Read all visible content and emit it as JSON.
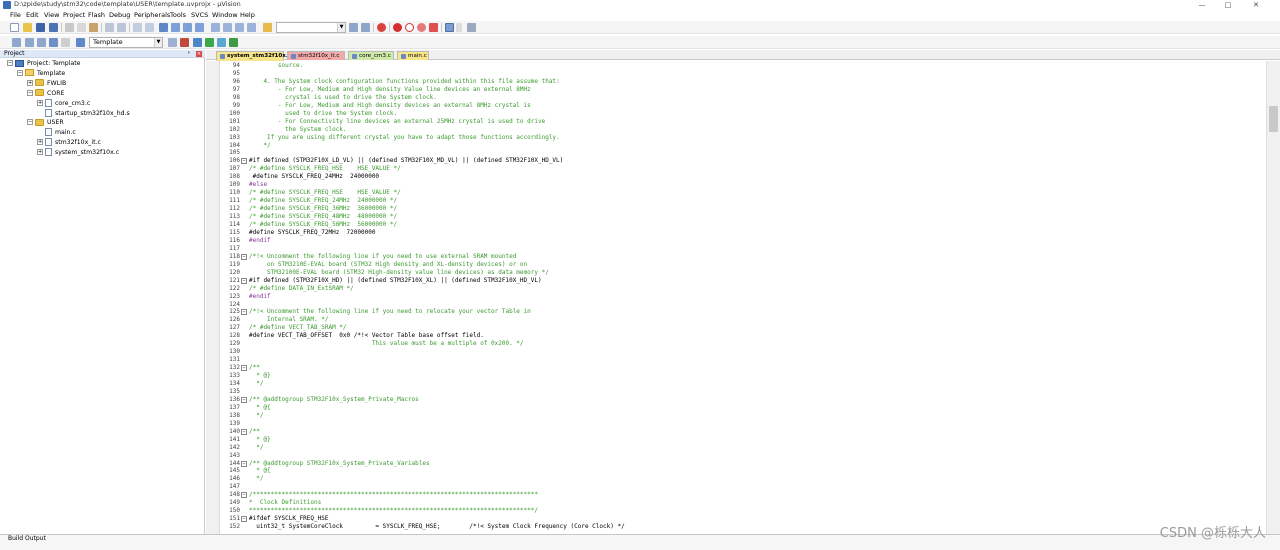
{
  "window": {
    "title": "D:\\zpide\\study\\stm32\\code\\template\\USER\\template.uvprojx - µVision",
    "controls": [
      "—",
      "□",
      "✕"
    ]
  },
  "menu": [
    "File",
    "Edit",
    "View",
    "Project",
    "Flash",
    "Debug",
    "Peripherals",
    "Tools",
    "SVCS",
    "Window",
    "Help"
  ],
  "toolbar": {
    "target_select": "Template"
  },
  "project_panel": {
    "header": "Project",
    "tree": [
      {
        "label": "Project: Template",
        "icon": "project-icon",
        "level": 0,
        "expander": "−"
      },
      {
        "label": "Template",
        "icon": "target-icon",
        "level": 1,
        "expander": "−"
      },
      {
        "label": "FWLIB",
        "icon": "folder-icon",
        "level": 2,
        "expander": "+"
      },
      {
        "label": "CORE",
        "icon": "folder-icon",
        "level": 2,
        "expander": "−"
      },
      {
        "label": "core_cm3.c",
        "icon": "file-icon",
        "level": 3,
        "expander": "+"
      },
      {
        "label": "startup_stm32f10x_hd.s",
        "icon": "file-icon",
        "level": 3,
        "expander": ""
      },
      {
        "label": "USER",
        "icon": "folder-icon",
        "level": 2,
        "expander": "−"
      },
      {
        "label": "main.c",
        "icon": "file-icon",
        "level": 3,
        "expander": ""
      },
      {
        "label": "stm32f10x_it.c",
        "icon": "file-icon",
        "level": 3,
        "expander": "+"
      },
      {
        "label": "system_stm32f10x.c",
        "icon": "file-icon",
        "level": 3,
        "expander": "+"
      }
    ]
  },
  "editor": {
    "tabs": [
      {
        "label": "system_stm32f10x.c",
        "active": true,
        "color": "#f7e58a"
      },
      {
        "label": "stm32f10x_it.c",
        "active": false,
        "color": "#f2a9a9"
      },
      {
        "label": "core_cm3.c",
        "active": false,
        "color": "#cfe9a9"
      },
      {
        "label": "main.c",
        "active": false,
        "color": "#f7e58a"
      }
    ],
    "lines": [
      {
        "n": "94",
        "t": "        source.",
        "c": "comment"
      },
      {
        "n": "95",
        "t": "",
        "c": "comment"
      },
      {
        "n": "96",
        "t": "    4. The System clock configuration functions provided within this file assume that:",
        "c": "comment"
      },
      {
        "n": "97",
        "t": "        - For Low, Medium and High density Value line devices an external 8MHz",
        "c": "comment"
      },
      {
        "n": "98",
        "t": "          crystal is used to drive the System clock.",
        "c": "comment"
      },
      {
        "n": "99",
        "t": "        - For Low, Medium and High density devices an external 8MHz crystal is",
        "c": "comment"
      },
      {
        "n": "100",
        "t": "          used to drive the System clock.",
        "c": "comment"
      },
      {
        "n": "101",
        "t": "        - For Connectivity line devices an external 25MHz crystal is used to drive",
        "c": "comment"
      },
      {
        "n": "102",
        "t": "          the System clock.",
        "c": "comment"
      },
      {
        "n": "103",
        "t": "     If you are using different crystal you have to adapt those functions accordingly.",
        "c": "comment"
      },
      {
        "n": "104",
        "t": "    */",
        "c": "comment"
      },
      {
        "n": "105",
        "t": "",
        "c": "def"
      },
      {
        "n": "106",
        "t": "#if defined (STM32F10X_LD_VL) || (defined STM32F10X_MD_VL) || (defined STM32F10X_HD_VL)",
        "c": "def",
        "fold": "−"
      },
      {
        "n": "107",
        "t": "/* #define SYSCLK_FREQ_HSE    HSE_VALUE */",
        "c": "comment"
      },
      {
        "n": "108",
        "t": " #define SYSCLK_FREQ_24MHz  24000000",
        "c": "def"
      },
      {
        "n": "109",
        "t": "#else",
        "c": "pre"
      },
      {
        "n": "110",
        "t": "/* #define SYSCLK_FREQ_HSE    HSE_VALUE */",
        "c": "comment"
      },
      {
        "n": "111",
        "t": "/* #define SYSCLK_FREQ_24MHz  24000000 */",
        "c": "comment"
      },
      {
        "n": "112",
        "t": "/* #define SYSCLK_FREQ_36MHz  36000000 */",
        "c": "comment"
      },
      {
        "n": "113",
        "t": "/* #define SYSCLK_FREQ_48MHz  48000000 */",
        "c": "comment"
      },
      {
        "n": "114",
        "t": "/* #define SYSCLK_FREQ_56MHz  56000000 */",
        "c": "comment"
      },
      {
        "n": "115",
        "t": "#define SYSCLK_FREQ_72MHz  72000000",
        "c": "def"
      },
      {
        "n": "116",
        "t": "#endif",
        "c": "pre"
      },
      {
        "n": "117",
        "t": "",
        "c": "def"
      },
      {
        "n": "118",
        "t": "/*!< Uncomment the following line if you need to use external SRAM mounted",
        "c": "comment",
        "fold": "−"
      },
      {
        "n": "119",
        "t": "     on STM3210E-EVAL board (STM32 High density and XL-density devices) or on",
        "c": "comment"
      },
      {
        "n": "120",
        "t": "     STM32100E-EVAL board (STM32 High-density value line devices) as data memory */",
        "c": "comment"
      },
      {
        "n": "121",
        "t": "#if defined (STM32F10X_HD) || (defined STM32F10X_XL) || (defined STM32F10X_HD_VL)",
        "c": "def",
        "fold": "−"
      },
      {
        "n": "122",
        "t": "/* #define DATA_IN_ExtSRAM */",
        "c": "comment"
      },
      {
        "n": "123",
        "t": "#endif",
        "c": "pre"
      },
      {
        "n": "124",
        "t": "",
        "c": "def"
      },
      {
        "n": "125",
        "t": "/*!< Uncomment the following line if you need to relocate your vector Table in",
        "c": "comment",
        "fold": "−"
      },
      {
        "n": "126",
        "t": "     Internal SRAM. */",
        "c": "comment"
      },
      {
        "n": "127",
        "t": "/* #define VECT_TAB_SRAM */",
        "c": "comment"
      },
      {
        "n": "128",
        "t": "#define VECT_TAB_OFFSET  0x0 /*!< Vector Table base offset field.",
        "c": "def"
      },
      {
        "n": "129",
        "t": "                                  This value must be a multiple of 0x200. */",
        "c": "comment"
      },
      {
        "n": "130",
        "t": "",
        "c": "def"
      },
      {
        "n": "131",
        "t": "",
        "c": "def"
      },
      {
        "n": "132",
        "t": "/**",
        "c": "comment",
        "fold": "−"
      },
      {
        "n": "133",
        "t": "  * @}",
        "c": "comment"
      },
      {
        "n": "134",
        "t": "  */",
        "c": "comment"
      },
      {
        "n": "135",
        "t": "",
        "c": "def"
      },
      {
        "n": "136",
        "t": "/** @addtogroup STM32F10x_System_Private_Macros",
        "c": "comment",
        "fold": "−"
      },
      {
        "n": "137",
        "t": "  * @{",
        "c": "comment"
      },
      {
        "n": "138",
        "t": "  */",
        "c": "comment"
      },
      {
        "n": "139",
        "t": "",
        "c": "def"
      },
      {
        "n": "140",
        "t": "/**",
        "c": "comment",
        "fold": "−"
      },
      {
        "n": "141",
        "t": "  * @}",
        "c": "comment"
      },
      {
        "n": "142",
        "t": "  */",
        "c": "comment"
      },
      {
        "n": "143",
        "t": "",
        "c": "def"
      },
      {
        "n": "144",
        "t": "/** @addtogroup STM32F10x_System_Private_Variables",
        "c": "comment",
        "fold": "−"
      },
      {
        "n": "145",
        "t": "  * @{",
        "c": "comment"
      },
      {
        "n": "146",
        "t": "  */",
        "c": "comment"
      },
      {
        "n": "147",
        "t": "",
        "c": "def"
      },
      {
        "n": "148",
        "t": "/*******************************************************************************",
        "c": "comment",
        "fold": "−"
      },
      {
        "n": "149",
        "t": "*  Clock Definitions",
        "c": "comment"
      },
      {
        "n": "150",
        "t": "*******************************************************************************/",
        "c": "comment"
      },
      {
        "n": "151",
        "t": "#ifdef SYSCLK_FREQ_HSE",
        "c": "def",
        "fold": "−"
      },
      {
        "n": "152",
        "t": "  uint32_t SystemCoreClock         = SYSCLK_FREQ_HSE;        /*!< System Clock Frequency (Core Clock) */",
        "c": "def"
      }
    ]
  },
  "build_output": {
    "label": "Build Output"
  },
  "watermark": "CSDN @栎栎大人"
}
